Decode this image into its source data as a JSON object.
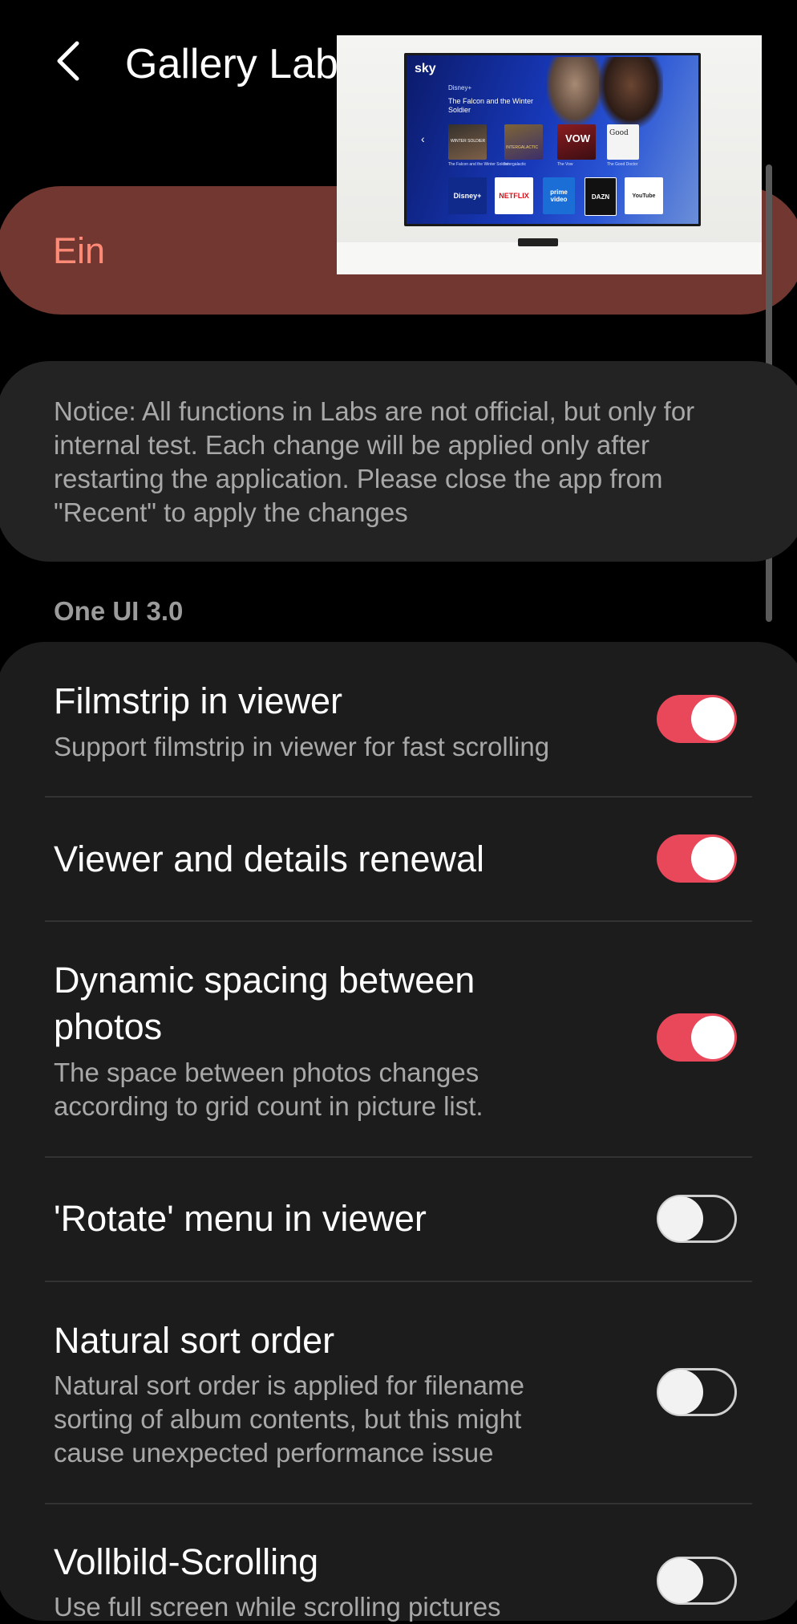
{
  "header": {
    "title": "Gallery Labs"
  },
  "master": {
    "label": "Ein",
    "on": true
  },
  "notice": {
    "text": "Notice: All functions in Labs are not official, but only for internal test. Each change will be applied only after restarting the application. Please close the app from \"Recent\" to apply the changes"
  },
  "section": {
    "title": "One UI 3.0"
  },
  "items": [
    {
      "title": "Filmstrip in viewer",
      "subtitle": "Support filmstrip in viewer for fast scrolling",
      "on": true
    },
    {
      "title": "Viewer and details renewal",
      "subtitle": "",
      "on": true
    },
    {
      "title_line1": "Dynamic spacing between",
      "title_line2": "photos",
      "subtitle_line1": "The space between photos changes",
      "subtitle_line2": "according to grid count in picture list.",
      "on": true
    },
    {
      "title": "'Rotate' menu in viewer",
      "subtitle": "",
      "on": false
    },
    {
      "title": "Natural sort order",
      "subtitle_line1": "Natural sort order is applied for filename",
      "subtitle_line2": "sorting of album contents, but this might",
      "subtitle_line3": "cause unexpected performance issue",
      "on": false
    },
    {
      "title": "Vollbild-Scrolling",
      "subtitle": "Use full screen while scrolling pictures",
      "on": false
    }
  ],
  "pip": {
    "brand": "sky",
    "service": "Disney+",
    "show_title": "The Falcon and the Winter Soldier",
    "tiles_row1": [
      "WINTER SOLDIER",
      "INTERGALACTIC",
      "VOW",
      "Good"
    ],
    "tiles_row1_captions": [
      "The Falcon and the Winter Soldier",
      "Intergalactic",
      "The Vow",
      "The Good Doctor"
    ],
    "tiles_row2": [
      "Disney+",
      "NETFLIX",
      "prime video",
      "DAZN",
      "YouTube"
    ]
  },
  "colors": {
    "accent": "#e8485a",
    "master_bg": "#713730",
    "master_text": "#ff8a76",
    "card_bg": "#1c1c1c"
  }
}
